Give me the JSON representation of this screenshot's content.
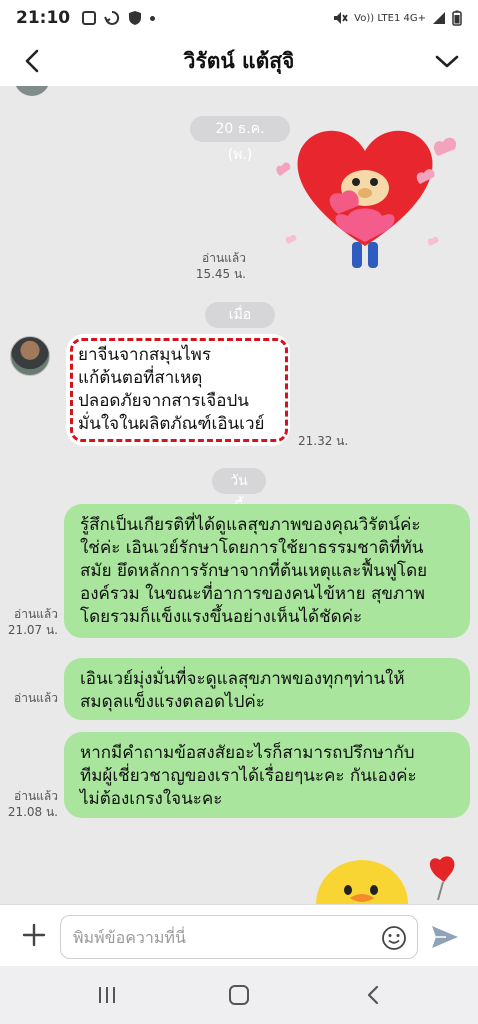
{
  "status_bar": {
    "time": "21:10",
    "network": "Vo)) LTE1 4G+"
  },
  "header": {
    "title": "วิรัตน์ แต้สุจิ",
    "back_icon": "chevron-left-icon",
    "menu_icon": "chevron-down-icon"
  },
  "chat": {
    "date_pills": [
      "20 ธ.ค. (พ.)",
      "เมื่อวาน",
      "วันนี้"
    ],
    "sticker1": {
      "read_label": "อ่านแล้ว",
      "time": "15.45 น."
    },
    "incoming": {
      "lines": [
        "ยาจีนจากสมุนไพร",
        "แก้ต้นตอที่สาเหตุ",
        "ปลอดภัยจากสารเจือปน",
        "มั่นใจในผลิตภัณฑ์เอินเวย์"
      ],
      "time": "21.32 น."
    },
    "outgoing": [
      {
        "lines": [
          "รู้สึกเป็นเกียรติที่ได้ดูแลสุขภาพของคุณวิรัตน์ค่ะ",
          "ใช่ค่ะ เอินเวย์รักษาโดยการใช้ยาธรรมชาติที่ทัน",
          "สมัย ยึดหลักการรักษาจากที่ต้นเหตุและฟื้นฟูโดย",
          "องค์รวม ในขณะที่อาการของคนไข้หาย สุขภาพ",
          "โดยรวมก็แข็งแรงขึ้นอย่างเห็นได้ชัดค่ะ"
        ],
        "read_label": "อ่านแล้ว",
        "time": "21.07 น."
      },
      {
        "lines": [
          "เอินเวย์มุ่งมั่นที่จะดูแลสุขภาพของทุกๆท่านให้",
          "สมดุลแข็งแรงตลอดไปค่ะ"
        ],
        "read_label": "อ่านแล้ว",
        "time": ""
      },
      {
        "lines": [
          "หากมีคำถามข้อสงสัยอะไรก็สามารถปรึกษากับ",
          "ทีมผู้เชี่ยวชาญของเราได้เรื่อยๆนะคะ กันเองค่ะ",
          "ไม่ต้องเกรงใจนะคะ"
        ],
        "read_label": "อ่านแล้ว",
        "time": "21.08 น."
      }
    ]
  },
  "input": {
    "placeholder": "พิมพ์ข้อความที่นี่",
    "plus_icon": "plus-icon",
    "emoji_icon": "emoji-icon",
    "send_icon": "send-icon"
  },
  "colors": {
    "bubble_out": "#a9e59c",
    "bubble_in": "#ffffff",
    "highlight_border": "#d3141c",
    "send": "#8fa3b8"
  },
  "nav": {
    "recent_icon": "recent-apps-icon",
    "home_icon": "home-icon",
    "back_icon": "back-icon"
  }
}
